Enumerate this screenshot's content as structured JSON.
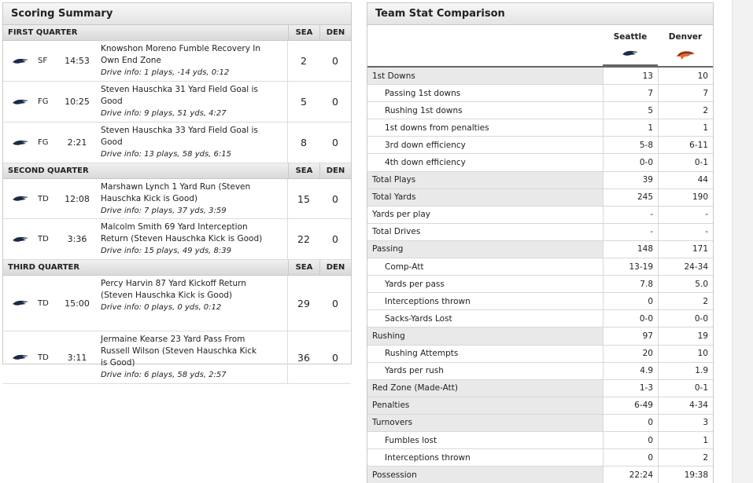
{
  "scoring": {
    "title": "Scoring Summary",
    "col_sea": "SEA",
    "col_den": "DEN",
    "quarters": [
      {
        "name": "FIRST QUARTER",
        "plays": [
          {
            "type": "SF",
            "time": "14:53",
            "lines": [
              "Knowshon Moreno Fumble Recovery In",
              "Own End Zone"
            ],
            "info": "Drive info: 1 plays, -14 yds, 0:12",
            "sea": "2",
            "den": "0"
          },
          {
            "type": "FG",
            "time": "10:25",
            "lines": [
              "Steven Hauschka 31 Yard Field Goal is",
              "Good"
            ],
            "info": "Drive info: 9 plays, 51 yds, 4:27",
            "sea": "5",
            "den": "0"
          },
          {
            "type": "FG",
            "time": "2:21",
            "lines": [
              "Steven Hauschka 33 Yard Field Goal is",
              "Good"
            ],
            "info": "Drive info: 13 plays, 58 yds, 6:15",
            "sea": "8",
            "den": "0"
          }
        ]
      },
      {
        "name": "SECOND QUARTER",
        "plays": [
          {
            "type": "TD",
            "time": "12:08",
            "lines": [
              "Marshawn Lynch 1 Yard Run (Steven",
              "Hauschka Kick is Good)"
            ],
            "info": "Drive info: 7 plays, 37 yds, 3:59",
            "sea": "15",
            "den": "0"
          },
          {
            "type": "TD",
            "time": "3:36",
            "lines": [
              "Malcolm Smith 69 Yard Interception",
              "Return (Steven Hauschka Kick is Good)"
            ],
            "info": "Drive info: 15 plays, 49 yds, 8:39",
            "sea": "22",
            "den": "0"
          }
        ]
      },
      {
        "name": "THIRD QUARTER",
        "plays": [
          {
            "type": "TD",
            "time": "15:00",
            "lines": [
              "Percy Harvin 87 Yard Kickoff Return",
              "(Steven Hauschka Kick is Good)"
            ],
            "info": "Drive info: 0 plays, 0 yds, 0:12",
            "sea": "29",
            "den": "0"
          },
          {
            "type": "TD",
            "time": "3:11",
            "lines": [
              "Jermaine Kearse 23 Yard Pass From",
              "Russell Wilson (Steven Hauschka Kick",
              "is Good)"
            ],
            "info": "Drive info: 6 plays, 58 yds, 2:57",
            "sea": "36",
            "den": "0"
          }
        ]
      }
    ]
  },
  "teamstats": {
    "title": "Team Stat Comparison",
    "team1": "Seattle",
    "team2": "Denver",
    "rows": [
      {
        "label": "1st Downs",
        "sea": "13",
        "den": "10",
        "sub": false,
        "shade": true
      },
      {
        "label": "Passing 1st downs",
        "sea": "7",
        "den": "7",
        "sub": true,
        "shade": false
      },
      {
        "label": "Rushing 1st downs",
        "sea": "5",
        "den": "2",
        "sub": true,
        "shade": false
      },
      {
        "label": "1st downs from penalties",
        "sea": "1",
        "den": "1",
        "sub": true,
        "shade": false
      },
      {
        "label": "3rd down efficiency",
        "sea": "5-8",
        "den": "6-11",
        "sub": true,
        "shade": false
      },
      {
        "label": "4th down efficiency",
        "sea": "0-0",
        "den": "0-1",
        "sub": true,
        "shade": false
      },
      {
        "label": "Total Plays",
        "sea": "39",
        "den": "44",
        "sub": false,
        "shade": true
      },
      {
        "label": "Total Yards",
        "sea": "245",
        "den": "190",
        "sub": false,
        "shade": true
      },
      {
        "label": "Yards per play",
        "sea": "-",
        "den": "-",
        "sub": false,
        "shade": false
      },
      {
        "label": "Total Drives",
        "sea": "-",
        "den": "-",
        "sub": false,
        "shade": false
      },
      {
        "label": "Passing",
        "sea": "148",
        "den": "171",
        "sub": false,
        "shade": true
      },
      {
        "label": "Comp-Att",
        "sea": "13-19",
        "den": "24-34",
        "sub": true,
        "shade": false
      },
      {
        "label": "Yards per pass",
        "sea": "7.8",
        "den": "5.0",
        "sub": true,
        "shade": false
      },
      {
        "label": "Interceptions thrown",
        "sea": "0",
        "den": "2",
        "sub": true,
        "shade": false
      },
      {
        "label": "Sacks-Yards Lost",
        "sea": "0-0",
        "den": "0-0",
        "sub": true,
        "shade": false
      },
      {
        "label": "Rushing",
        "sea": "97",
        "den": "19",
        "sub": false,
        "shade": true
      },
      {
        "label": "Rushing Attempts",
        "sea": "20",
        "den": "10",
        "sub": true,
        "shade": false
      },
      {
        "label": "Yards per rush",
        "sea": "4.9",
        "den": "1.9",
        "sub": true,
        "shade": false
      },
      {
        "label": "Red Zone (Made-Att)",
        "sea": "1-3",
        "den": "0-1",
        "sub": false,
        "shade": true
      },
      {
        "label": "Penalties",
        "sea": "6-49",
        "den": "4-34",
        "sub": false,
        "shade": true
      },
      {
        "label": "Turnovers",
        "sea": "0",
        "den": "3",
        "sub": false,
        "shade": true
      },
      {
        "label": "Fumbles lost",
        "sea": "0",
        "den": "1",
        "sub": true,
        "shade": false
      },
      {
        "label": "Interceptions thrown",
        "sea": "0",
        "den": "2",
        "sub": true,
        "shade": false
      },
      {
        "label": "Possession",
        "sea": "22:24",
        "den": "19:38",
        "sub": false,
        "shade": true
      }
    ]
  },
  "icons": {
    "seahawks": "seahawks-logo-icon",
    "broncos": "broncos-logo-icon"
  },
  "colors": {
    "seahawks_navy": "#1b2a4a",
    "seahawks_green": "#6aa84f",
    "broncos_orange": "#f26522",
    "broncos_navy": "#0b2265"
  }
}
